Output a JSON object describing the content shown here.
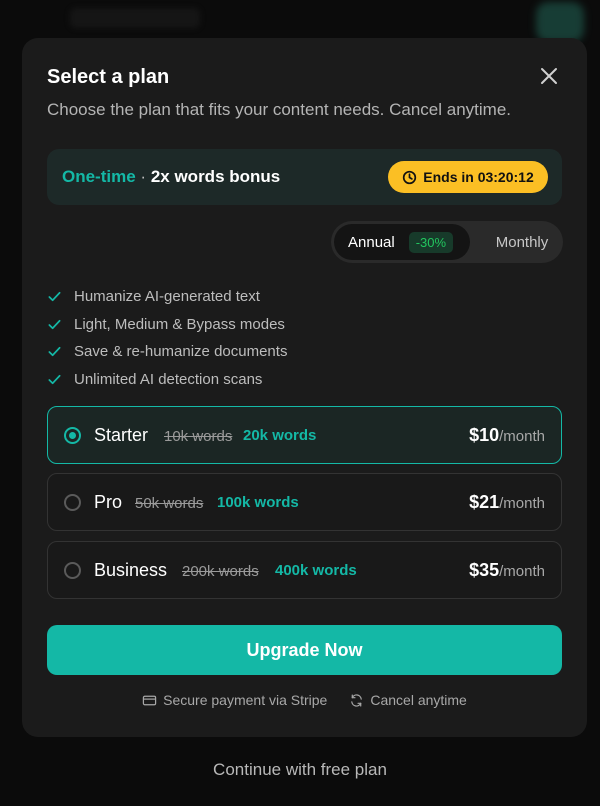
{
  "modal": {
    "title": "Select a plan",
    "subtitle": "Choose the plan that fits your content needs. Cancel anytime."
  },
  "bonus": {
    "label": "One-time",
    "separator": "·",
    "text": "2x words bonus",
    "timer": "Ends in 03:20:12"
  },
  "billing": {
    "annual_label": "Annual",
    "annual_discount": "-30%",
    "monthly_label": "Monthly",
    "selected": "Annual"
  },
  "features": [
    "Humanize AI-generated text",
    "Light, Medium & Bypass modes",
    "Save & re-humanize documents",
    "Unlimited AI detection scans"
  ],
  "plans": [
    {
      "name": "Starter",
      "old_words": "10k words",
      "new_words": "20k words",
      "price": "$10",
      "period": "/month",
      "selected": true
    },
    {
      "name": "Pro",
      "old_words": "50k words",
      "new_words": "100k words",
      "price": "$21",
      "period": "/month",
      "selected": false
    },
    {
      "name": "Business",
      "old_words": "200k words",
      "new_words": "400k words",
      "price": "$35",
      "period": "/month",
      "selected": false
    }
  ],
  "cta": {
    "label": "Upgrade Now"
  },
  "footnotes": {
    "secure": "Secure payment via Stripe",
    "cancel": "Cancel anytime"
  },
  "continue_free": "Continue with free plan",
  "colors": {
    "accent": "#14b8a6",
    "timer_bg": "#fbbf24",
    "discount": "#22c55e",
    "modal_bg": "#1b1b1b"
  },
  "icons": [
    "close-icon",
    "clock-icon",
    "check-icon",
    "card-icon",
    "refresh-icon"
  ]
}
